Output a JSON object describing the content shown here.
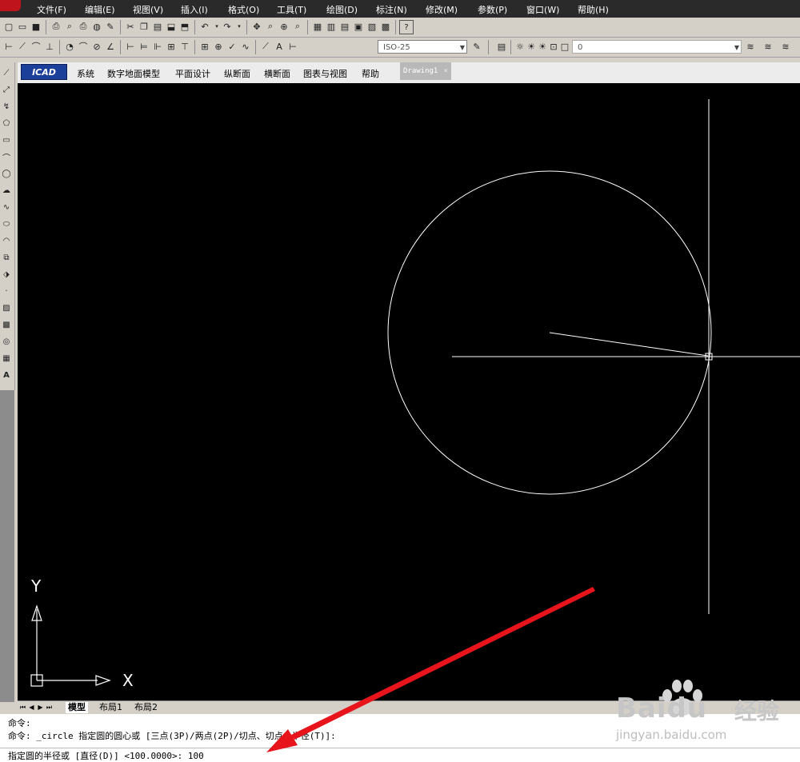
{
  "menubar": {
    "items": [
      "文件(F)",
      "编辑(E)",
      "视图(V)",
      "插入(I)",
      "格式(O)",
      "工具(T)",
      "绘图(D)",
      "标注(N)",
      "修改(M)",
      "参数(P)",
      "窗口(W)",
      "帮助(H)"
    ]
  },
  "toolbar2": {
    "dimstyle": "ISO-25",
    "layer": "0"
  },
  "appbar": {
    "logo": "ICAD",
    "menus": [
      "系统",
      "数字地面模型",
      "平面设计",
      "纵断面",
      "横断面",
      "图表与视图",
      "帮助"
    ],
    "drawing_tab": "Drawing1",
    "drawing_tab_close": "×"
  },
  "ucs": {
    "x_label": "X",
    "y_label": "Y"
  },
  "layout_tabs": [
    "模型",
    "布局1",
    "布局2"
  ],
  "command": {
    "line1": "命令:",
    "line2": "命令: _circle 指定圆的圆心或 [三点(3P)/两点(2P)/切点、切点、半径(T)]:",
    "line3": "指定圆的半径或 [直径(D)] <100.0000>: 100"
  },
  "watermark": {
    "brand": "Baidu",
    "sub_brand": "经验",
    "url": "jingyan.baidu.com"
  },
  "colors": {
    "menubar_bg": "#2a2a2a",
    "canvas_bg": "#000000",
    "annotation_arrow": "#e8141c",
    "drawing_lines": "#ffffff"
  }
}
